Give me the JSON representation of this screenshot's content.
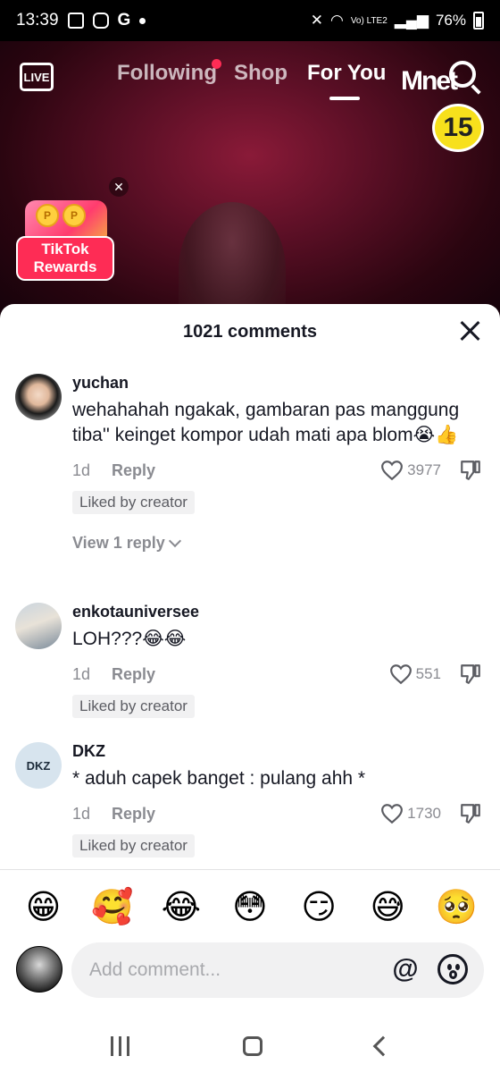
{
  "status_bar": {
    "time": "13:39",
    "battery": "76%",
    "network": "Vo) LTE2"
  },
  "top_nav": {
    "live_label": "LIVE",
    "tabs": [
      {
        "label": "Following",
        "has_dot": true
      },
      {
        "label": "Shop"
      },
      {
        "label": "For You",
        "active": true
      }
    ],
    "channel_logo": "Mnet",
    "age_rating": "15"
  },
  "rewards": {
    "label": "TikTok Rewards",
    "coin": "P"
  },
  "comments_sheet": {
    "title": "1021 comments",
    "comments": [
      {
        "username": "yuchan",
        "text": "wehahahah ngakak, gambaran pas manggung tiba'' keinget kompor udah mati apa blom😭👍",
        "time": "1d",
        "reply_label": "Reply",
        "likes": "3977",
        "badge": "Liked by creator",
        "view_replies": "View 1 reply"
      },
      {
        "username": "enkotauniversee",
        "text": "LOH???😂😂",
        "time": "1d",
        "reply_label": "Reply",
        "likes": "551",
        "badge": "Liked by creator"
      },
      {
        "username": "DKZ",
        "avatar_text": "DKZ",
        "text": "* aduh capek banget : pulang ahh *",
        "time": "1d",
        "reply_label": "Reply",
        "likes": "1730",
        "badge": "Liked by creator"
      }
    ],
    "emojis": [
      "😁",
      "🥰",
      "😂",
      "😳",
      "😏",
      "😅",
      "🥺"
    ],
    "input_placeholder": "Add comment...",
    "at_symbol": "@"
  },
  "colors": {
    "accent": "#fe2c55",
    "text_primary": "#161823",
    "text_secondary": "#8a8b91",
    "badge_bg": "#f1f1f2"
  }
}
